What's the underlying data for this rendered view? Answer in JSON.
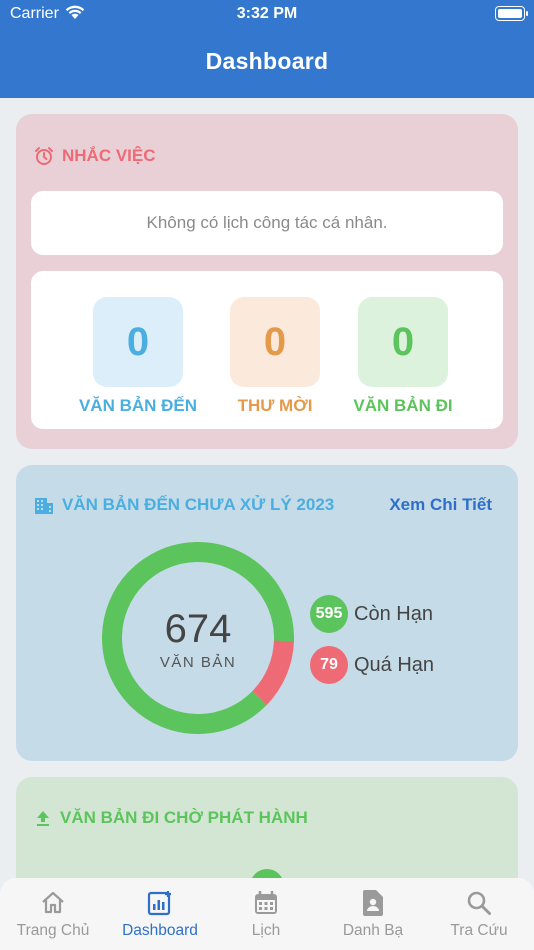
{
  "status_bar": {
    "carrier": "Carrier",
    "time": "3:32 PM"
  },
  "header": {
    "title": "Dashboard"
  },
  "reminder": {
    "title": "NHẮC VIỆC",
    "empty_text": "Không có lịch công tác cá nhân.",
    "stats": [
      {
        "value": "0",
        "label": "VĂN BẢN ĐẾN",
        "color": "#4aaee0",
        "bg": "#dbeefa"
      },
      {
        "value": "0",
        "label": "THƯ MỜI",
        "color": "#e39a4a",
        "bg": "#fbeadb"
      },
      {
        "value": "0",
        "label": "VĂN BẢN ĐI",
        "color": "#5cc45c",
        "bg": "#ddf2dd"
      }
    ]
  },
  "incoming": {
    "title": "VĂN BẢN ĐẾN CHƯA XỬ LÝ 2023",
    "detail_link": "Xem Chi Tiết",
    "total": "674",
    "total_label": "VĂN BẢN",
    "legend": [
      {
        "value": "595",
        "label": "Còn Hạn",
        "color": "#5cc45c"
      },
      {
        "value": "79",
        "label": "Quá Hạn",
        "color": "#ee6a74"
      }
    ]
  },
  "outgoing": {
    "title": "VĂN BẢN ĐI CHỜ PHÁT HÀNH"
  },
  "tabs": [
    {
      "label": "Trang Chủ",
      "icon": "home-icon"
    },
    {
      "label": "Dashboard",
      "icon": "dashboard-icon",
      "active": true
    },
    {
      "label": "Lịch",
      "icon": "calendar-icon"
    },
    {
      "label": "Danh Bạ",
      "icon": "contacts-icon"
    },
    {
      "label": "Tra Cứu",
      "icon": "search-icon"
    }
  ],
  "colors": {
    "primary": "#3477cf",
    "green": "#5cc45c",
    "red": "#ee6a74",
    "blue_title": "#4aaee0",
    "red_title": "#ee6a74"
  }
}
